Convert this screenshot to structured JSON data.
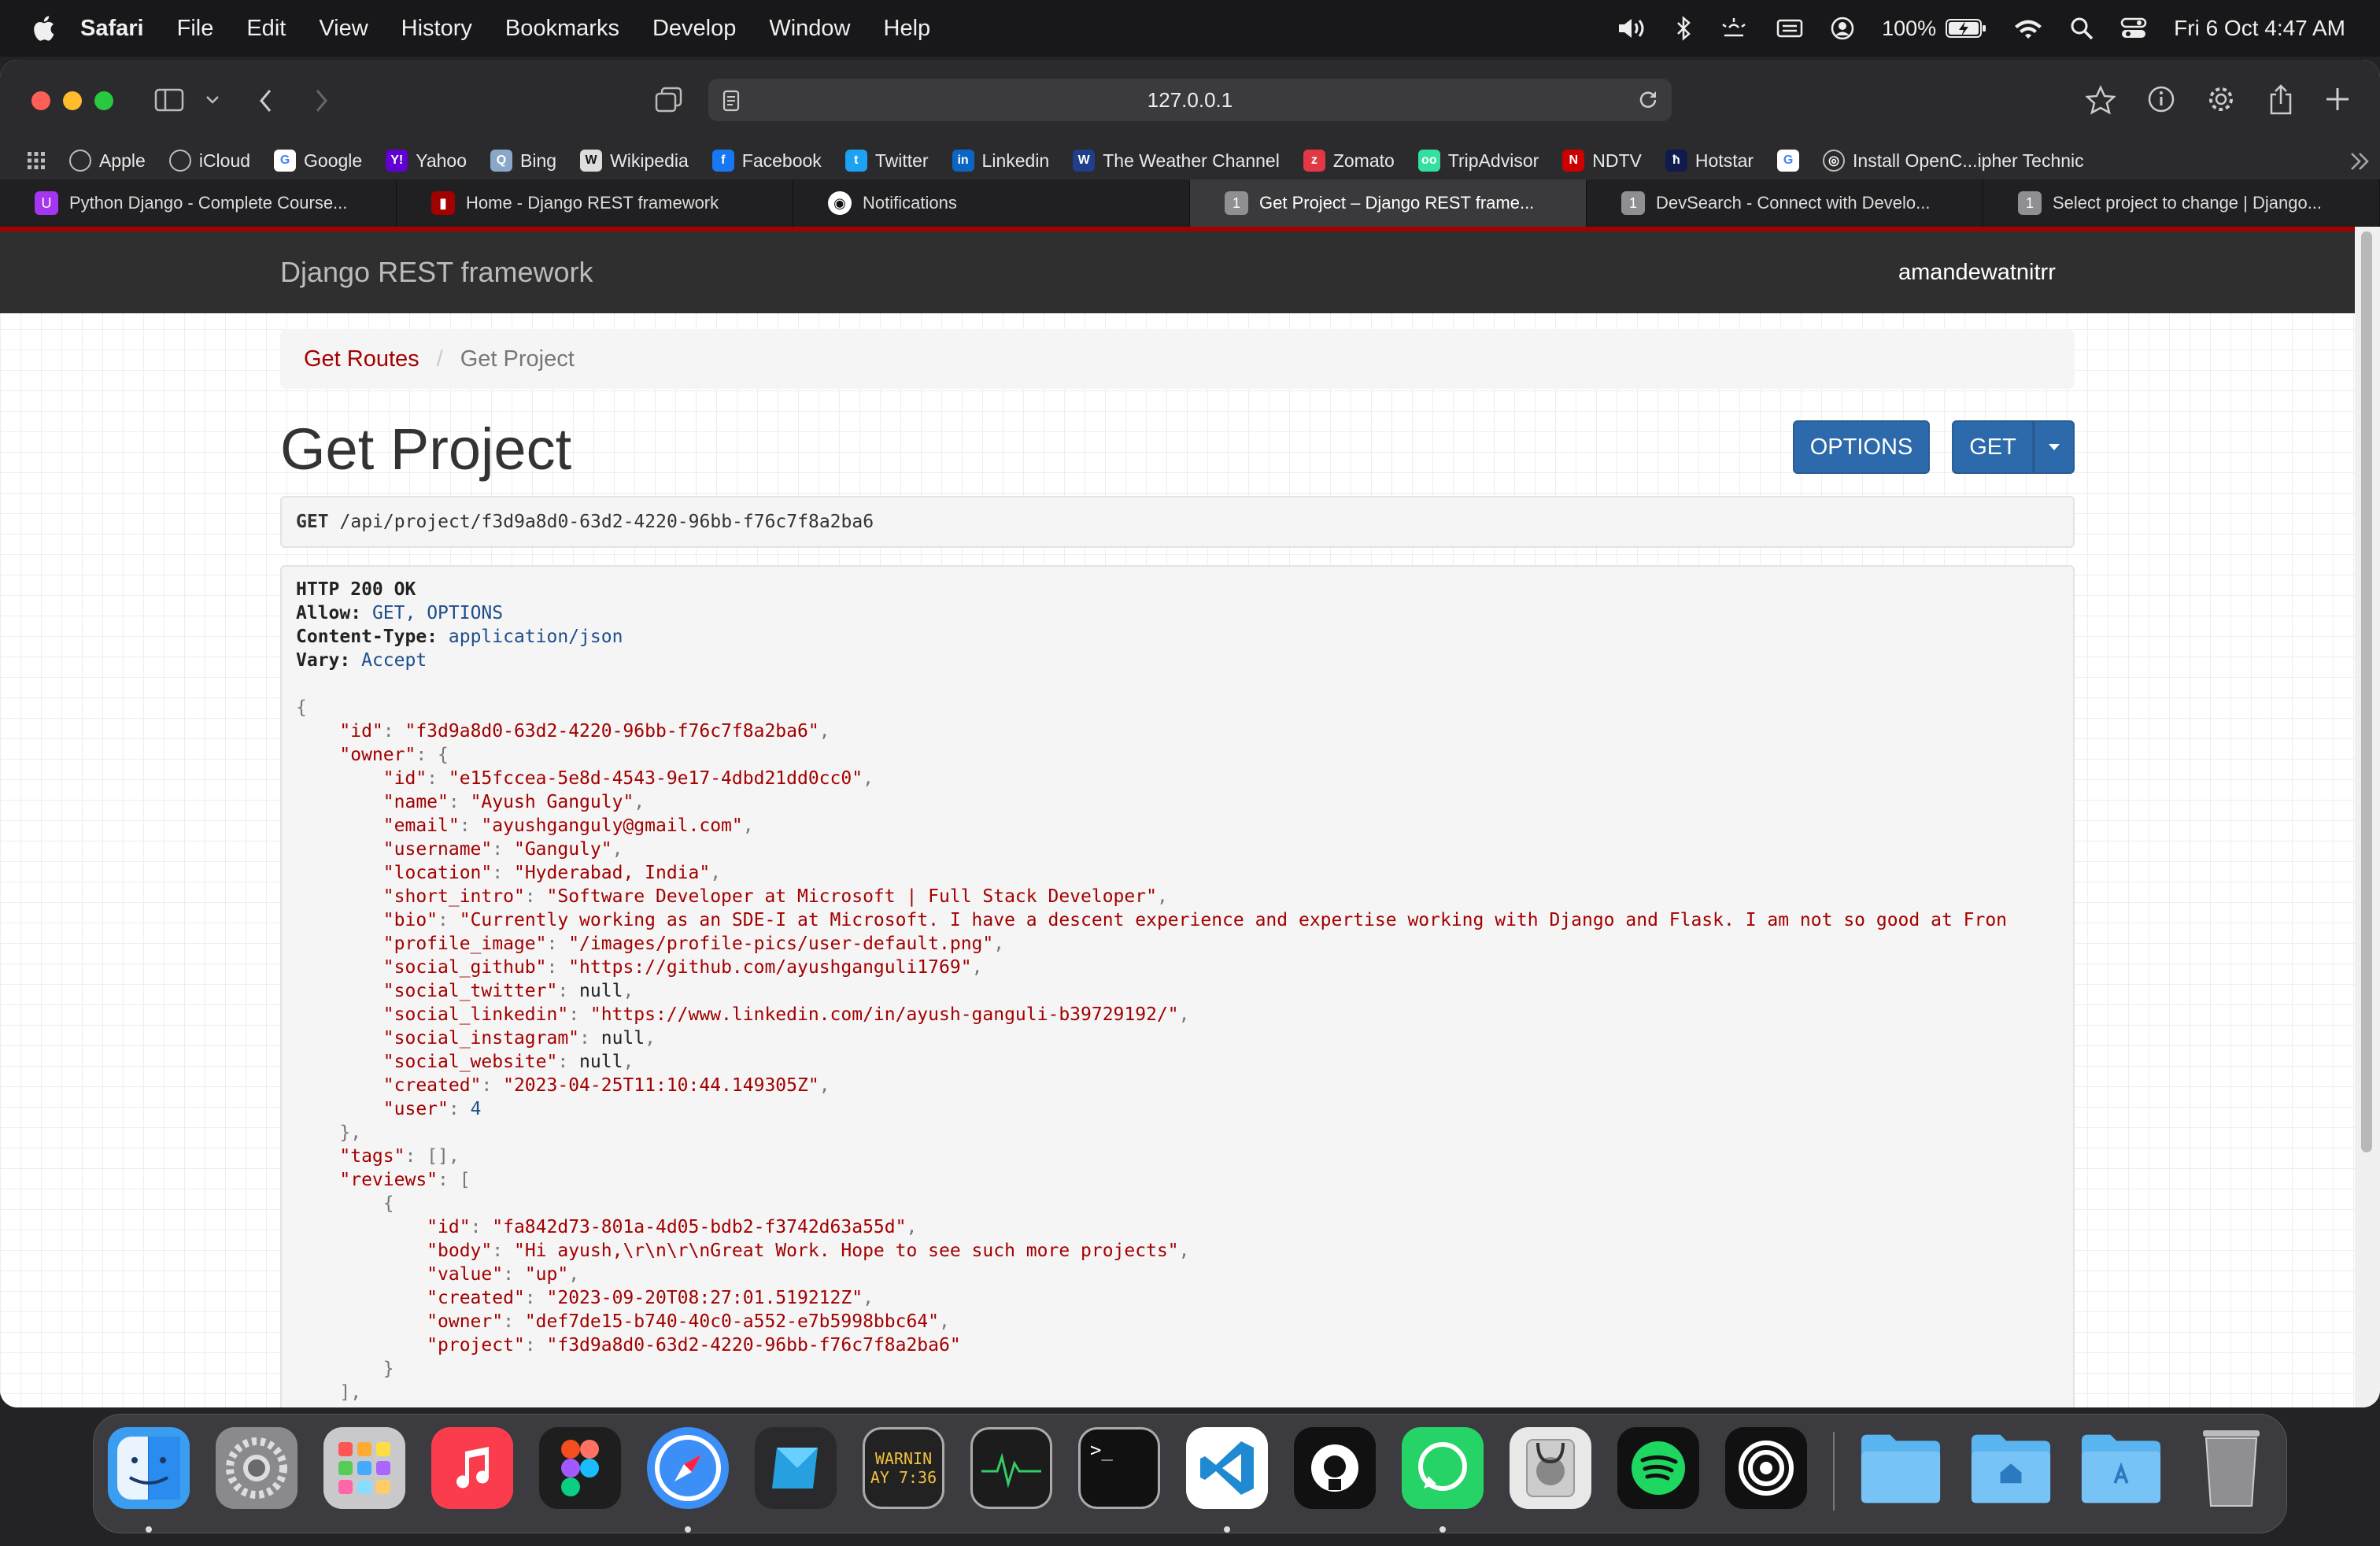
{
  "menubar": {
    "app": "Safari",
    "items": [
      "File",
      "Edit",
      "View",
      "History",
      "Bookmarks",
      "Develop",
      "Window",
      "Help"
    ],
    "battery": "100%",
    "datetime": "Fri 6 Oct  4:47 AM"
  },
  "browser": {
    "url": "127.0.0.1",
    "bookmarks": [
      {
        "label": "Apple",
        "icon": "apple-icon",
        "color": "#555"
      },
      {
        "label": "iCloud",
        "icon": "apple-icon",
        "color": "#555"
      },
      {
        "label": "Google",
        "icon": "google-icon",
        "color": "#fff"
      },
      {
        "label": "Yahoo",
        "icon": "yahoo-icon",
        "color": "#6001d2"
      },
      {
        "label": "Bing",
        "icon": "bing-icon",
        "color": "#8aa6c9"
      },
      {
        "label": "Wikipedia",
        "icon": "wikipedia-icon",
        "color": "#ddd"
      },
      {
        "label": "Facebook",
        "icon": "facebook-icon",
        "color": "#1877f2"
      },
      {
        "label": "Twitter",
        "icon": "twitter-icon",
        "color": "#1da1f2"
      },
      {
        "label": "Linkedin",
        "icon": "linkedin-icon",
        "color": "#0a66c2"
      },
      {
        "label": "The Weather Channel",
        "icon": "weather-channel-icon",
        "color": "#1f3f8c"
      },
      {
        "label": "Zomato",
        "icon": "zomato-icon",
        "color": "#e23744"
      },
      {
        "label": "TripAdvisor",
        "icon": "tripadvisor-icon",
        "color": "#34e0a1"
      },
      {
        "label": "NDTV",
        "icon": "ndtv-icon",
        "color": "#c00"
      },
      {
        "label": "Hotstar",
        "icon": "hotstar-icon",
        "color": "#0f1b4c"
      },
      {
        "label": "",
        "icon": "google-icon",
        "color": "#fff"
      },
      {
        "label": "Install OpenC...ipher Technic",
        "icon": "globe-icon",
        "color": "#555"
      }
    ],
    "tabs": [
      {
        "label": "Python Django - Complete Course...",
        "icon": "udemy-icon",
        "color": "#a435f0",
        "active": false
      },
      {
        "label": "Home - Django REST framework",
        "icon": "drf-icon",
        "color": "#a30000",
        "active": false
      },
      {
        "label": "Notifications",
        "icon": "github-icon",
        "color": "#222",
        "active": false
      },
      {
        "label": "Get Project – Django REST frame...",
        "icon": "tab-1-icon",
        "color": "#8e8e93",
        "active": true
      },
      {
        "label": "DevSearch - Connect with Develo...",
        "icon": "tab-1-icon",
        "color": "#8e8e93",
        "active": false
      },
      {
        "label": "Select project to change | Django...",
        "icon": "tab-1-icon",
        "color": "#8e8e93",
        "active": false
      }
    ],
    "tab_badge": "1"
  },
  "page": {
    "brand": "Django REST framework",
    "user": "amandewatnitrr",
    "breadcrumb": {
      "link": "Get Routes",
      "separator": "/",
      "current": "Get Project"
    },
    "title": "Get Project",
    "options_button": "OPTIONS",
    "get_button": "GET",
    "request": {
      "method": "GET",
      "path": "/api/project/f3d9a8d0-63d2-4220-96bb-f76c7f8a2ba6"
    },
    "response_headers": [
      {
        "key": "HTTP 200 OK",
        "value": ""
      },
      {
        "key": "Allow:",
        "value": "GET, OPTIONS"
      },
      {
        "key": "Content-Type:",
        "value": "application/json"
      },
      {
        "key": "Vary:",
        "value": "Accept"
      }
    ],
    "response_lines": [
      {
        "indent": 0,
        "key": "",
        "value": "{",
        "type": "p"
      },
      {
        "indent": 1,
        "key": "\"id\"",
        "value": "\"f3d9a8d0-63d2-4220-96bb-f76c7f8a2ba6\"",
        "type": "s",
        "comma": true
      },
      {
        "indent": 1,
        "key": "\"owner\"",
        "value": "{",
        "type": "p"
      },
      {
        "indent": 2,
        "key": "\"id\"",
        "value": "\"e15fccea-5e8d-4543-9e17-4dbd21dd0cc0\"",
        "type": "s",
        "comma": true
      },
      {
        "indent": 2,
        "key": "\"name\"",
        "value": "\"Ayush Ganguly\"",
        "type": "s",
        "comma": true
      },
      {
        "indent": 2,
        "key": "\"email\"",
        "value": "\"ayushganguly@gmail.com\"",
        "type": "s",
        "comma": true
      },
      {
        "indent": 2,
        "key": "\"username\"",
        "value": "\"Ganguly\"",
        "type": "s",
        "comma": true
      },
      {
        "indent": 2,
        "key": "\"location\"",
        "value": "\"Hyderabad, India\"",
        "type": "s",
        "comma": true
      },
      {
        "indent": 2,
        "key": "\"short_intro\"",
        "value": "\"Software Developer at Microsoft | Full Stack Developer\"",
        "type": "s",
        "comma": true
      },
      {
        "indent": 2,
        "key": "\"bio\"",
        "value": "\"Currently working as an SDE-I at Microsoft. I have a descent experience and expertise working with Django and Flask. I am not so good at Fron",
        "type": "s",
        "comma": false
      },
      {
        "indent": 2,
        "key": "\"profile_image\"",
        "value": "\"/images/profile-pics/user-default.png\"",
        "type": "s",
        "comma": true
      },
      {
        "indent": 2,
        "key": "\"social_github\"",
        "value": "\"https://github.com/ayushganguli1769\"",
        "type": "s",
        "comma": true
      },
      {
        "indent": 2,
        "key": "\"social_twitter\"",
        "value": "null",
        "type": "l",
        "comma": true
      },
      {
        "indent": 2,
        "key": "\"social_linkedin\"",
        "value": "\"https://www.linkedin.com/in/ayush-ganguli-b39729192/\"",
        "type": "s",
        "comma": true
      },
      {
        "indent": 2,
        "key": "\"social_instagram\"",
        "value": "null",
        "type": "l",
        "comma": true
      },
      {
        "indent": 2,
        "key": "\"social_website\"",
        "value": "null",
        "type": "l",
        "comma": true
      },
      {
        "indent": 2,
        "key": "\"created\"",
        "value": "\"2023-04-25T11:10:44.149305Z\"",
        "type": "s",
        "comma": true
      },
      {
        "indent": 2,
        "key": "\"user\"",
        "value": "4",
        "type": "n",
        "comma": false
      },
      {
        "indent": 1,
        "key": "",
        "value": "},",
        "type": "p"
      },
      {
        "indent": 1,
        "key": "\"tags\"",
        "value": "[],",
        "type": "p"
      },
      {
        "indent": 1,
        "key": "\"reviews\"",
        "value": "[",
        "type": "p"
      },
      {
        "indent": 2,
        "key": "",
        "value": "{",
        "type": "p"
      },
      {
        "indent": 3,
        "key": "\"id\"",
        "value": "\"fa842d73-801a-4d05-bdb2-f3742d63a55d\"",
        "type": "s",
        "comma": true
      },
      {
        "indent": 3,
        "key": "\"body\"",
        "value": "\"Hi ayush,\\r\\n\\r\\nGreat Work. Hope to see such more projects\"",
        "type": "s",
        "comma": true
      },
      {
        "indent": 3,
        "key": "\"value\"",
        "value": "\"up\"",
        "type": "s",
        "comma": true
      },
      {
        "indent": 3,
        "key": "\"created\"",
        "value": "\"2023-09-20T08:27:01.519212Z\"",
        "type": "s",
        "comma": true
      },
      {
        "indent": 3,
        "key": "\"owner\"",
        "value": "\"def7de15-b740-40c0-a552-e7b5998bbc64\"",
        "type": "s",
        "comma": true
      },
      {
        "indent": 3,
        "key": "\"project\"",
        "value": "\"f3d9a8d0-63d2-4220-96bb-f76c7f8a2ba6\"",
        "type": "s",
        "comma": false
      },
      {
        "indent": 2,
        "key": "",
        "value": "}",
        "type": "p"
      },
      {
        "indent": 1,
        "key": "",
        "value": "],",
        "type": "p"
      }
    ]
  },
  "dock": {
    "apps": [
      {
        "name": "finder-icon",
        "color": "#3a9df0",
        "running": true
      },
      {
        "name": "system-settings-icon",
        "color": "#8a8a8e",
        "running": false
      },
      {
        "name": "launchpad-icon",
        "color": "#c9c9cc",
        "running": false
      },
      {
        "name": "music-icon",
        "color": "#fa3c4c",
        "running": false
      },
      {
        "name": "figma-icon",
        "color": "#1e1e1e",
        "running": false
      },
      {
        "name": "safari-icon",
        "color": "#3b8ff7",
        "running": true
      },
      {
        "name": "cursor-app-icon",
        "color": "#2a2a2c",
        "running": false
      },
      {
        "name": "console-icon",
        "color": "#222",
        "running": false
      },
      {
        "name": "activity-monitor-icon",
        "color": "#1c1c1c",
        "running": false
      },
      {
        "name": "terminal-icon",
        "color": "#111",
        "running": false
      },
      {
        "name": "vscode-icon",
        "color": "#ffffff",
        "running": true
      },
      {
        "name": "github-desktop-icon",
        "color": "#111",
        "running": false
      },
      {
        "name": "whatsapp-icon",
        "color": "#25d366",
        "running": true
      },
      {
        "name": "disk-utility-icon",
        "color": "#e8e8e8",
        "running": false
      },
      {
        "name": "spotify-icon",
        "color": "#111",
        "running": false
      },
      {
        "name": "pock-icon",
        "color": "#111",
        "running": false
      }
    ],
    "console_text": [
      "WARNIN",
      "AY 7:36"
    ],
    "terminal_text": ">_",
    "folders": [
      {
        "name": "documents-folder-icon",
        "color": "#5ab4f0"
      },
      {
        "name": "home-folder-icon",
        "color": "#5ab4f0"
      },
      {
        "name": "applications-folder-icon",
        "color": "#5ab4f0"
      },
      {
        "name": "trash-icon",
        "color": "#9a9a9e"
      }
    ]
  }
}
